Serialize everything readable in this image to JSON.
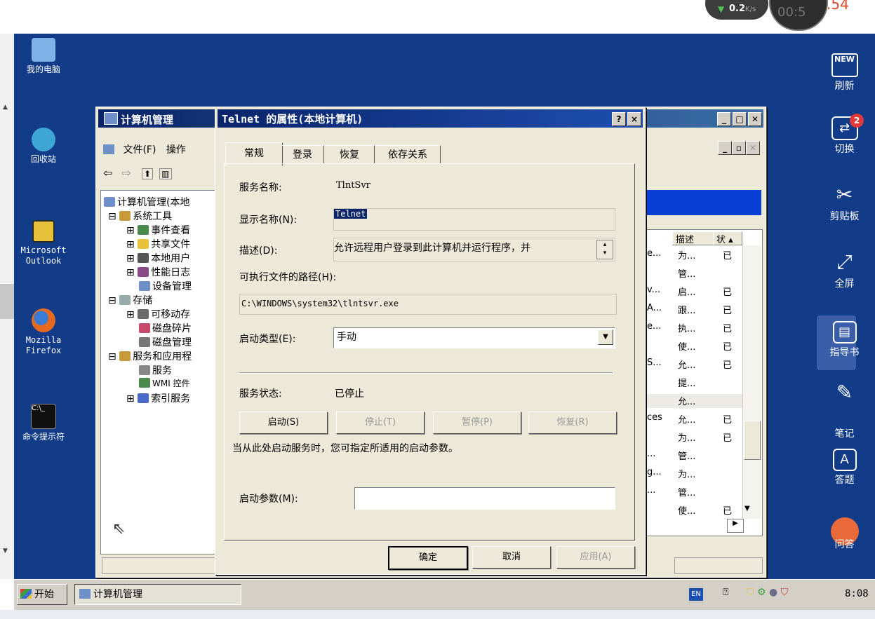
{
  "top": {
    "speed_value": "0.2",
    "speed_unit": "K/s",
    "clock_dim": "00:5",
    "clock_sec": ".54"
  },
  "desktop_icons": [
    {
      "label": "我的电脑",
      "color": "#7fb2e6"
    },
    {
      "label": "回收站",
      "color": "#3fa7d6"
    },
    {
      "label": "Microsoft Outlook",
      "color": "#e8c23a"
    },
    {
      "label": "Mozilla Firefox",
      "color": "#e66a1e"
    },
    {
      "label": "命令提示符",
      "color": "#111111"
    }
  ],
  "right_toolbar": [
    {
      "label": "刷新",
      "icon": "new-icon",
      "icon_text": "NEW"
    },
    {
      "label": "切换",
      "icon": "switch-icon",
      "badge": "2"
    },
    {
      "label": "剪贴板",
      "icon": "scissors-icon"
    },
    {
      "label": "全屏",
      "icon": "fullscreen-icon"
    },
    {
      "label": "指导书",
      "icon": "book-icon"
    },
    {
      "label": "笔记",
      "icon": "pen-icon"
    },
    {
      "label": "答题",
      "icon": "answer-icon"
    },
    {
      "label": "问答",
      "icon": "qa-icon"
    }
  ],
  "mgmt": {
    "title": "计算机管理",
    "menu": [
      "文件(F)",
      "操作"
    ],
    "tree": [
      "计算机管理(本地",
      "系统工具",
      "事件查看",
      "共享文件",
      "本地用户",
      "性能日志",
      "设备管理",
      "存储",
      "可移动存",
      "磁盘碎片",
      "磁盘管理",
      "服务和应用程",
      "服务",
      "WMI 控件",
      "索引服务"
    ],
    "list_headers": [
      "描述",
      "状"
    ],
    "list": [
      {
        "a": "e...",
        "d": "为...",
        "s": "已"
      },
      {
        "a": "",
        "d": "管...",
        "s": ""
      },
      {
        "a": "v...",
        "d": "启...",
        "s": "已"
      },
      {
        "a": "A...",
        "d": "跟...",
        "s": "已"
      },
      {
        "a": "e...",
        "d": "执...",
        "s": "已"
      },
      {
        "a": "",
        "d": "使...",
        "s": "已"
      },
      {
        "a": "S...",
        "d": "允...",
        "s": "已"
      },
      {
        "a": "",
        "d": "提...",
        "s": ""
      },
      {
        "a": "",
        "d": "允...",
        "s": ""
      },
      {
        "a": "ces",
        "d": "允...",
        "s": "已"
      },
      {
        "a": "",
        "d": "为...",
        "s": "已"
      },
      {
        "a": "...",
        "d": "管...",
        "s": ""
      },
      {
        "a": "g...",
        "d": "为...",
        "s": ""
      },
      {
        "a": "...",
        "d": "管...",
        "s": ""
      },
      {
        "a": "",
        "d": "使...",
        "s": "已"
      }
    ]
  },
  "dialog": {
    "title": "Telnet 的属性(本地计算机)",
    "help": "?",
    "close": "×",
    "tabs": [
      "常规",
      "登录",
      "恢复",
      "依存关系"
    ],
    "service_name_label": "服务名称:",
    "service_name": "TlntSvr",
    "display_name_label": "显示名称(N):",
    "display_name": "Telnet",
    "desc_label": "描述(D):",
    "desc": "允许远程用户登录到此计算机并运行程序，并",
    "path_label": "可执行文件的路径(H):",
    "path": "C:\\WINDOWS\\system32\\tlntsvr.exe",
    "startup_label": "启动类型(E):",
    "startup_value": "手动",
    "status_label": "服务状态:",
    "status_value": "已停止",
    "buttons": {
      "start": "启动(S)",
      "stop": "停止(T)",
      "pause": "暂停(P)",
      "resume": "恢复(R)"
    },
    "hint": "当从此处启动服务时，您可指定所适用的启动参数。",
    "params_label": "启动参数(M):",
    "params_value": "",
    "ok": "确定",
    "cancel": "取消",
    "apply": "应用(A)"
  },
  "taskbar": {
    "start": "开始",
    "task": "计算机管理",
    "lang": "EN",
    "time": "8:08"
  }
}
